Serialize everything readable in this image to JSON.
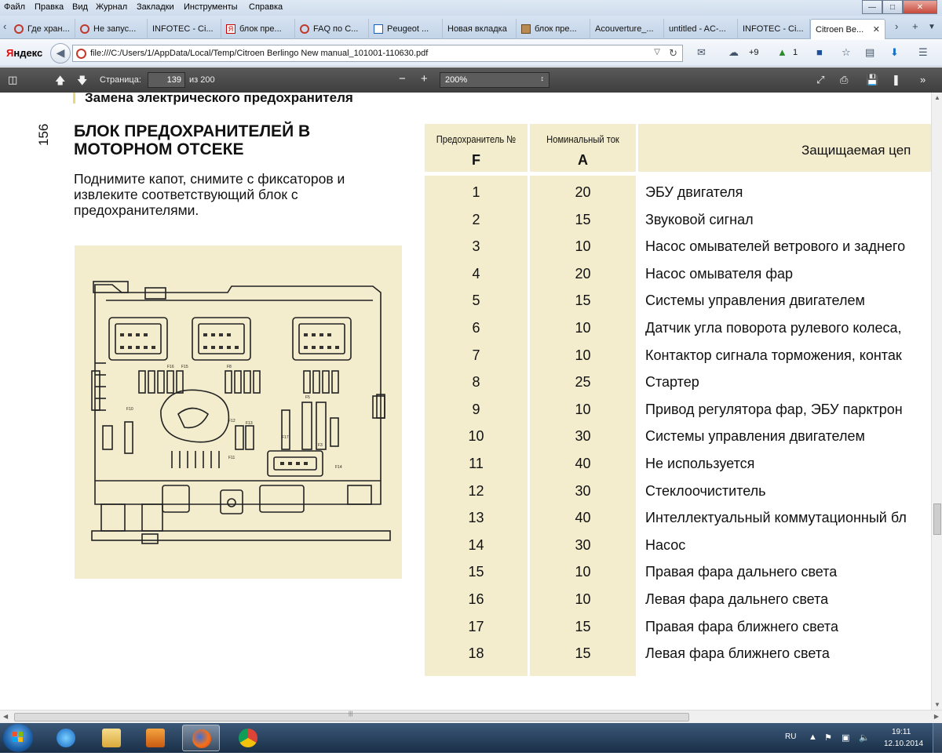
{
  "menubar": {
    "items": [
      "Файл",
      "Правка",
      "Вид",
      "Журнал",
      "Закладки",
      "Инструменты",
      "Справка"
    ]
  },
  "tabs": [
    {
      "label": "Где хран...",
      "icon": "red-circle-icon"
    },
    {
      "label": "Не запус...",
      "icon": "red-circle-icon"
    },
    {
      "label": "INFOTEC - Ci...",
      "icon": "none"
    },
    {
      "label": "блок пре...",
      "icon": "yandex-icon"
    },
    {
      "label": "FAQ по С...",
      "icon": "red-circle-icon"
    },
    {
      "label": "Peugeot ...",
      "icon": "doc-icon"
    },
    {
      "label": "Новая вкладка",
      "icon": "none"
    },
    {
      "label": "блок пре...",
      "icon": "image-icon"
    },
    {
      "label": "Acouverture_...",
      "icon": "none"
    },
    {
      "label": "untitled - AC-...",
      "icon": "none"
    },
    {
      "label": "INFOTEC - Ci...",
      "icon": "none"
    },
    {
      "label": "Citroen Be...",
      "icon": "none",
      "active": true
    }
  ],
  "address": {
    "logo_ya": "Я",
    "logo_rest": "ндекс",
    "url": "file:///C:/Users/1/AppData/Local/Temp/Citroen Berlingo New manual_101001-110630.pdf",
    "weather": "+9",
    "counter": "1"
  },
  "pdf_toolbar": {
    "page_label": "Страница:",
    "page_value": "139",
    "page_total": "из 200",
    "zoom": "200%"
  },
  "document": {
    "section_title": "Замена электрического предохранителя",
    "page_number": "156",
    "heading": "БЛОК ПРЕДОХРАНИТЕЛЕЙ В МОТОРНОМ ОТСЕКЕ",
    "text": "Поднимите капот, снимите с фиксаторов и извлеките соответствующий блок с предохранителями.",
    "diagram_labels": [
      "F16",
      "F15",
      "F10",
      "F8",
      "F5",
      "F12",
      "F11",
      "F17",
      "F3",
      "F14",
      "F13"
    ]
  },
  "fuse_table": {
    "header": {
      "fuse_no": "Предохранитель №",
      "fuse_letter": "F",
      "current": "Номинальный ток",
      "current_letter": "A",
      "circuit": "Защищаемая цеп"
    },
    "rows": [
      {
        "f": "1",
        "a": "20",
        "desc": "ЭБУ двигателя"
      },
      {
        "f": "2",
        "a": "15",
        "desc": "Звуковой сигнал"
      },
      {
        "f": "3",
        "a": "10",
        "desc": "Насос омывателей ветрового и заднего"
      },
      {
        "f": "4",
        "a": "20",
        "desc": "Насос омывателя фар"
      },
      {
        "f": "5",
        "a": "15",
        "desc": "Системы управления двигателем"
      },
      {
        "f": "6",
        "a": "10",
        "desc": "Датчик угла поворота рулевого колеса,"
      },
      {
        "f": "7",
        "a": "10",
        "desc": "Контактор сигнала торможения, контак"
      },
      {
        "f": "8",
        "a": "25",
        "desc": "Стартер"
      },
      {
        "f": "9",
        "a": "10",
        "desc": "Привод регулятора фар, ЭБУ парктрон"
      },
      {
        "f": "10",
        "a": "30",
        "desc": "Системы управления двигателем"
      },
      {
        "f": "11",
        "a": "40",
        "desc": "Не используется"
      },
      {
        "f": "12",
        "a": "30",
        "desc": "Стеклоочиститель"
      },
      {
        "f": "13",
        "a": "40",
        "desc": "Интеллектуальный коммутационный бл"
      },
      {
        "f": "14",
        "a": "30",
        "desc": "Насос"
      },
      {
        "f": "15",
        "a": "10",
        "desc": "Правая фара дальнего света"
      },
      {
        "f": "16",
        "a": "10",
        "desc": "Левая фара дальнего света"
      },
      {
        "f": "17",
        "a": "15",
        "desc": "Правая фара ближнего света"
      },
      {
        "f": "18",
        "a": "15",
        "desc": "Левая фара ближнего света"
      }
    ]
  },
  "taskbar": {
    "apps": [
      "start-orb",
      "internet-explorer",
      "file-explorer",
      "media-player",
      "firefox",
      "chrome"
    ],
    "lang": "RU",
    "time": "19:11",
    "date": "12.10.2014"
  },
  "colors": {
    "table_bg": "#f3edce",
    "pdf_toolbar": "#4a4a4a",
    "taskbar": "#2a4565"
  }
}
